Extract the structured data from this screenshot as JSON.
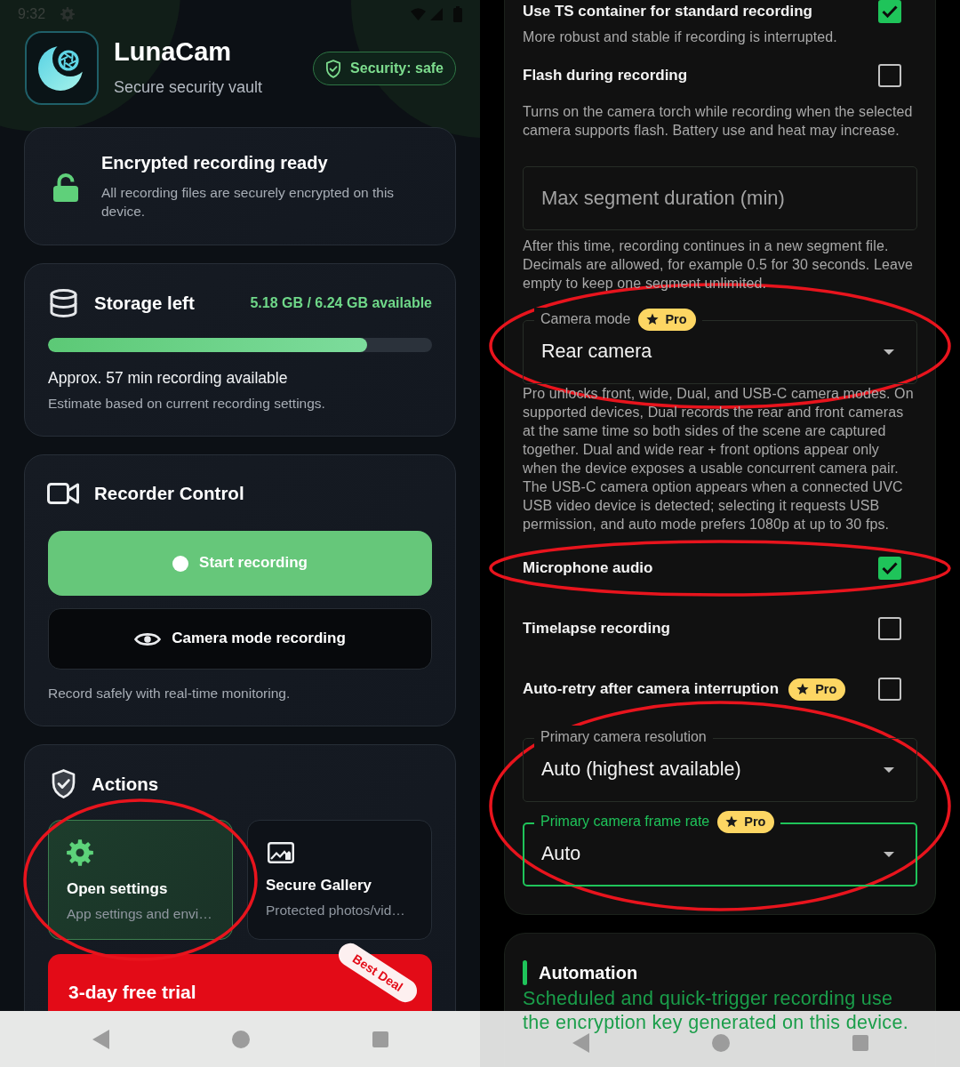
{
  "left_screen": {
    "status_bar": {
      "time": "9:32"
    },
    "header": {
      "app_name": "LunaCam",
      "tagline": "Secure security vault",
      "security_status": "Security: safe"
    },
    "encryption_card": {
      "title": "Encrypted recording ready",
      "description": "All recording files are securely encrypted on this device."
    },
    "storage_card": {
      "title": "Storage left",
      "amount": "5.18 GB / 6.24 GB available",
      "level": 0.83,
      "estimate": "Approx. 57 min recording available",
      "note": "Estimate based on current recording settings."
    },
    "recorder_card": {
      "title": "Recorder Control",
      "buttons": [
        {
          "kind": "primary",
          "label": "Start recording"
        },
        {
          "kind": "outline",
          "label": "Camera mode recording"
        }
      ],
      "note": "Record safely with real-time monitoring."
    },
    "actions_card": {
      "title": "Actions",
      "tiles": [
        {
          "kind": "settings",
          "title": "Open settings",
          "subtitle": "App settings and envi…",
          "selected": true,
          "circled": true
        },
        {
          "kind": "gallery",
          "title": "Secure Gallery",
          "subtitle": "Protected photos/vid…",
          "selected": false
        }
      ],
      "promo": {
        "title": "3-day free trial",
        "ribbon": "Best Deal"
      }
    }
  },
  "right_screen": {
    "settings": [
      {
        "kind": "checkbox",
        "label": "Use TS container for standard recording",
        "checked": true,
        "description": "More robust and stable if recording is interrupted."
      },
      {
        "kind": "checkbox",
        "label": "Flash during recording",
        "checked": false,
        "description": "Turns on the camera torch while recording when the selected camera supports flash. Battery use and heat may increase."
      },
      {
        "kind": "field",
        "placeholder": "Max segment duration (min)",
        "description": "After this time, recording continues in a new segment file. Decimals are allowed, for example 0.5 for 30 seconds. Leave empty to keep one segment unlimited."
      },
      {
        "kind": "select",
        "label": "Camera mode",
        "badge": "Pro",
        "value": "Rear camera",
        "focused": false,
        "circled": true,
        "description": "Pro unlocks front, wide, Dual, and USB-C camera modes. On supported devices, Dual records the rear and front cameras at the same time so both sides of the scene are captured together. Dual and wide rear + front options appear only when the device exposes a usable concurrent camera pair. The USB-C camera option appears when a connected UVC USB video device is detected; selecting it requests USB permission, and auto mode prefers 1080p at up to 30 fps."
      },
      {
        "kind": "checkbox",
        "label": "Microphone audio",
        "checked": true,
        "circled": true
      },
      {
        "kind": "checkbox",
        "label": "Timelapse recording",
        "checked": false
      },
      {
        "kind": "checkbox",
        "label": "Auto-retry after camera interruption",
        "badge": "Pro",
        "checked": false
      },
      {
        "kind": "select",
        "label": "Primary camera resolution",
        "value": "Auto (highest available)",
        "focused": false,
        "circled": true
      },
      {
        "kind": "select",
        "label": "Primary camera frame rate",
        "badge": "Pro",
        "value": "Auto",
        "focused": true,
        "circled": true
      }
    ],
    "automation": {
      "title": "Automation",
      "description": "Scheduled and quick-trigger recording use the encryption key generated on this device."
    }
  }
}
